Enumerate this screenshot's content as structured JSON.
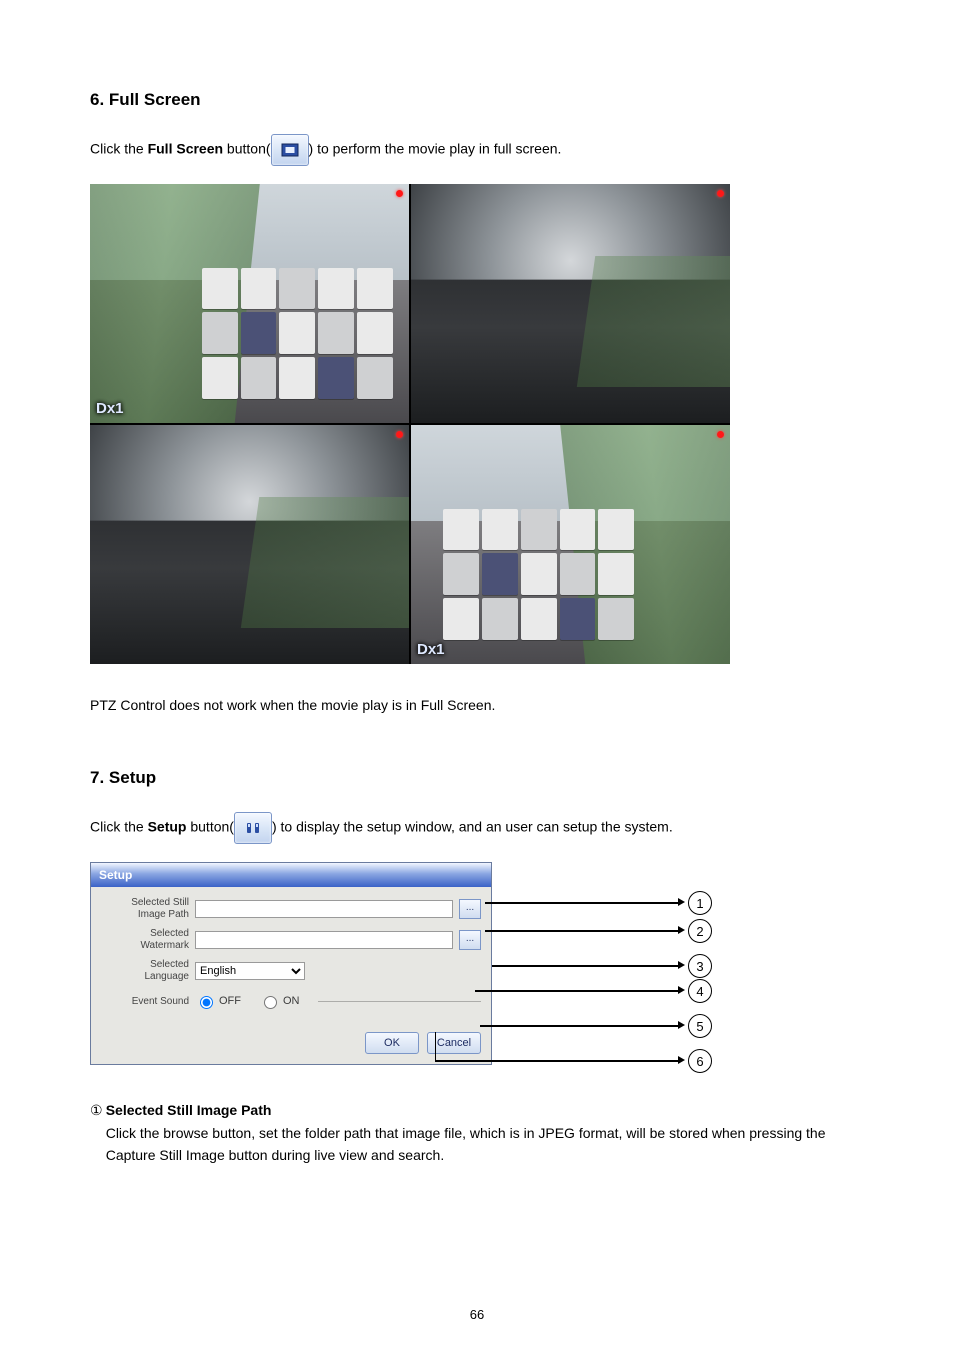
{
  "section_fullscreen": {
    "number": "6.",
    "title": "Full Screen",
    "body_prefix": "Click the ",
    "body_strong": "Full Screen",
    "body_middle": " button(",
    "body_suffix": ") to perform the movie play in full screen.",
    "icon_name": "full-screen-icon",
    "note": "PTZ Control does not work when the movie play is in Full Screen.",
    "pane_label": "Dx1"
  },
  "section_setup": {
    "number": "7.",
    "title": "Setup",
    "body_prefix": "Click the ",
    "body_strong": "Setup",
    "body_middle": " button(",
    "body_suffix": ") to display the setup window, and an user can setup the system.",
    "icon_name": "setup-icon",
    "dialog": {
      "title": "Setup",
      "labels": {
        "still_path": "Selected Still\nImage Path",
        "watermark": "Selected\nWatermark",
        "language": "Selected\nLanguage",
        "event_sound": "Event Sound"
      },
      "fields": {
        "still_path_value": "",
        "watermark_value": "",
        "language_options": [
          "English"
        ],
        "language_selected": "English",
        "event_sound_off": "OFF",
        "event_sound_on": "ON",
        "event_sound_selected": "OFF",
        "browse_label": "...",
        "ok_label": "OK",
        "cancel_label": "Cancel"
      }
    },
    "callouts": [
      "1",
      "2",
      "3",
      "4",
      "5",
      "6"
    ],
    "description": {
      "num": "①",
      "heading": "Selected Still Image Path",
      "body": "Click the browse button, set the folder path that image file, which is in JPEG format, will be stored when pressing the Capture Still Image button during live view and search."
    }
  },
  "page_number": "66"
}
